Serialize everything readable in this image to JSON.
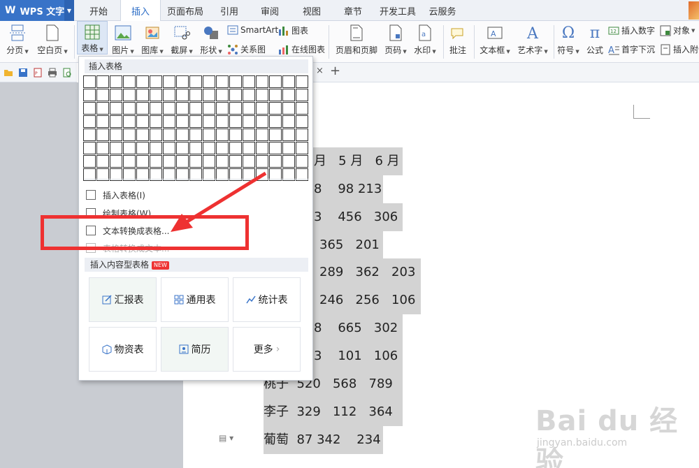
{
  "app": {
    "name": "WPS 文字"
  },
  "menu": {
    "tabs": [
      "开始",
      "插入",
      "页面布局",
      "引用",
      "审阅",
      "视图",
      "章节",
      "开发工具",
      "云服务"
    ],
    "active_index": 1
  },
  "ribbon": {
    "page_break": "分页",
    "blank_page": "空白页",
    "table": "表格",
    "picture": "图片",
    "gallery": "图库",
    "screenshot": "截屏",
    "shape": "形状",
    "smartart": "SmartArt",
    "chart": "图表",
    "relation": "关系图",
    "online_chart": "在线图表",
    "header_footer": "页眉和页脚",
    "page_number": "页码",
    "watermark": "水印",
    "comment": "批注",
    "textbox": "文本框",
    "wordart": "艺术字",
    "symbol": "符号",
    "formula": "公式",
    "insert_number": "插入数字",
    "object": "对象",
    "dropcap": "首字下沉",
    "insert_attachment": "插入附件"
  },
  "doc_tab": {
    "close": "×",
    "add": "+"
  },
  "dropdown": {
    "title": "插入表格",
    "grid": {
      "cols": 17,
      "rows": 8
    },
    "items": [
      "插入表格(I)",
      "绘制表格(W)",
      "文本转换成表格...",
      "表格转换成文本..."
    ],
    "section_title": "插入内容型表格",
    "new_badge": "NEW",
    "cards": [
      "汇报表",
      "通用表",
      "统计表",
      "物资表",
      "简历",
      "更多"
    ]
  },
  "document": {
    "rows": [
      {
        "text": "月   5 月   6 月"
      },
      {
        "text": "8    98 213"
      },
      {
        "text": "3    456   306"
      },
      {
        "text": "365   201"
      },
      {
        "text": "289   362   203"
      },
      {
        "text": "246   256   106"
      },
      {
        "text": "8    665   302"
      },
      {
        "text": "3    101   106"
      },
      {
        "text": "桃子  520   568   789"
      },
      {
        "text": "李子  329   112   364"
      },
      {
        "text": "葡萄  87 342    234"
      }
    ]
  },
  "watermark": {
    "brand": "Bai du 经验",
    "url": "jingyan.baidu.com"
  },
  "colors": {
    "accent": "#3873c8",
    "annotation": "#ee3131",
    "highlight": "#d3d3d3"
  }
}
